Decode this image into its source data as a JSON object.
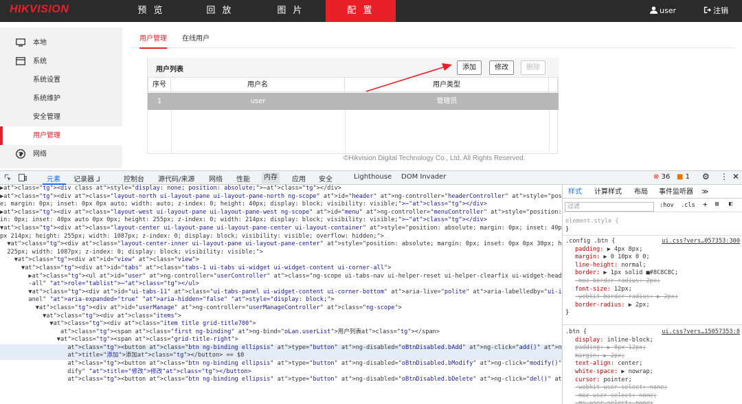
{
  "header": {
    "logo": "HIKVISION",
    "nav": [
      "预 览",
      "回 放",
      "图 片",
      "配 置"
    ],
    "user": "user",
    "logout": "注销"
  },
  "sidebar": {
    "items": [
      "本地",
      "系统",
      "系统设置",
      "系统维护",
      "安全管理",
      "用户管理",
      "网络"
    ]
  },
  "tabs": [
    "用户管理",
    "在线用户"
  ],
  "user_list": {
    "title": "用户列表",
    "buttons": {
      "add": "添加",
      "modify": "修改",
      "delete": "删除"
    },
    "columns": [
      "序号",
      "用户名",
      "用户类型"
    ],
    "rows": [
      {
        "index": "1",
        "name": "user",
        "type": "管理员"
      }
    ]
  },
  "footer": "©Hikvision Digital Technology Co., Ltd. All Rights Reserved.",
  "devtools": {
    "tabs": [
      "元素",
      "记录器 ⅃",
      "控制台",
      "源代码/来源",
      "网络",
      "性能",
      "内存",
      "应用",
      "安全",
      "Lighthouse",
      "DOM Invader"
    ],
    "errors": "36",
    "warnings": "1",
    "dom_lines": [
      "▶<div class style=\"display: none; position: absolute;\">⋯</div>",
      "▶<div class=\"layout-north ui-layout-pane ui-layout-pane-north ng-scope\" id=\"header\" ng-controller=\"headerController\" style=\"position: absolut",
      "e; margin: 0px; inset: 0px 0px auto; width: auto; z-index: 0; height: 40px; display: block; visibility: visible;\">⋯</div>",
      "▶<div class=\"layout-west ui-layout-pane ui-layout-pane-west ng-scope\" id=\"menu\" ng-controller=\"menuController\" style=\"position: absolute; marg",
      "in: 0px; inset: 40px auto 0px 0px; height: 255px; z-index: 0; width: 214px; display: block; visibility: visible;\">⋯</div>",
      "▼<div class=\"layout-center ui-layout-pane ui-layout-pane-center ui-layout-container\" style=\"position: absolute; margin: 0px; inset: 40px 0px 0",
      "px 214px; height: 255px; width: 1087px; z-index: 0; display: block; visibility: visible; overflow: hidden;\">",
      "  ▼<div class=\"layout-center-inner ui-layout-pane ui-layout-pane-center\" style=\"position: absolute; margin: 0px; inset: 0px 0px 30px; height:",
      "  225px; width: 1087px; z-index: 0; display: block; visibility: visible;\">",
      "    ▼<div id=\"view\" class=\"view\">",
      "      ▼<div id=\"tabs\" class=\"tabs-1 ui-tabs ui-widget ui-widget-content ui-corner-all\">",
      "        ▶<ul id=\"user\" ng-controller=\"userController\" class=\"ng-scope ui-tabs-nav ui-helper-reset ui-helper-clearfix ui-widget-header ui-corner",
      "        -all\" role=\"tablist\">⋯</ul>",
      "        ▼<div id=\"ui-tabs-11\" class=\"ui-tabs-panel ui-widget-content ui-corner-bottom\" aria-live=\"polite\" aria-labelledby=\"ui-id-11\" role=\"tabp",
      "        anel\" aria-expanded=\"true\" aria-hidden=\"false\" style=\"display: block;\">",
      "          ▼<div id=\"userManage\" ng-controller=\"userManageController\" class=\"ng-scope\">",
      "            ▼<div class=\"items\">",
      "              ▼<div class=\"item title grid-title700\">",
      "                 <span class=\"first ng-binding\" ng-bind=\"oLan.userList\">用户列表</span>",
      "                ▼<span class=\"grid-title-right\">",
      "                   <button class=\"btn ng-binding ellipsis\" type=\"button\" ng-disabled=\"oBtnDisabled.bAdd\" ng-click=\"add()\" ng-bind=\"oLan.add\"",
      "                   title=\"添加\">添加</button> == $0",
      "                   <button class=\"btn ng-binding ellipsis\" type=\"button\" ng-disabled=\"oBtnDisabled.bModify\" ng-click=\"modify()\" ng-bind=\"oLan.mo",
      "                   dify\" title=\"修改\">修改</button>",
      "                   <button class=\"btn ng-binding ellipsis\" type=\"button\" ng-disabled=\"oBtnDisabled.bDelete\" ng-click=\"del()\" ng-bind=\"oLan.del\""
    ],
    "styles": {
      "tabs": [
        "样式",
        "计算样式",
        "布局",
        "事件监听器",
        "≫"
      ],
      "filter_placeholder": "过滤",
      "hov": ":hov",
      "cls": ".cls",
      "element_style": "element.style {",
      "rule1_selector": ".config .btn {",
      "rule1_source": "ui.css?vers…057353:300",
      "rule1_props": [
        "padding: ▶ 4px 8px;",
        "margin: ▶ 0 10px 0 0;",
        "line-height: normal;",
        "border: ▶ 1px solid ■#8C8C8C;",
        "-moz-border-radius: 2px;",
        "font-size: 12px;",
        "-webkit-border-radius: ▶ 2px;",
        "border-radius: ▶ 2px;"
      ],
      "rule2_selector": ".btn {",
      "rule2_source": "ui.css?vers…15057353:8",
      "rule2_props": [
        "display: inline-block;",
        "padding: ▶ 8px 12px;",
        "margin: ▶ 2px;",
        "text-align: center;",
        "white-space: ▶ nowrap;",
        "cursor: pointer;",
        "-webkit-user-select: none;",
        "-moz-user-select: none;",
        "-ms-user-select: none;"
      ]
    }
  }
}
